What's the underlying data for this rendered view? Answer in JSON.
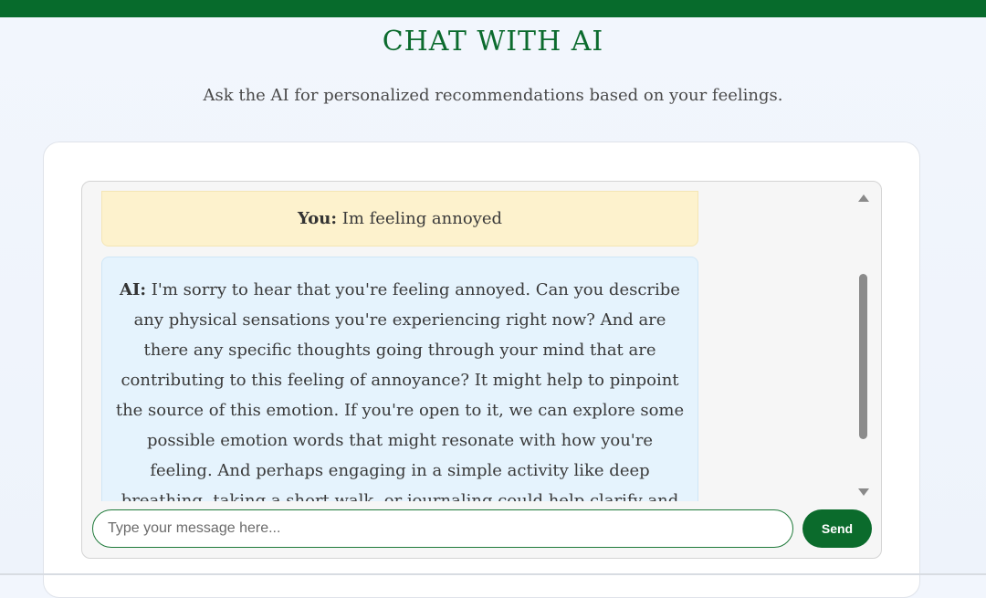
{
  "header": {
    "title": "CHAT WITH AI",
    "subtitle": "Ask the AI for personalized recommendations based on your feelings."
  },
  "chat": {
    "messages": [
      {
        "sender": "You:",
        "text": "Im feeling annoyed"
      },
      {
        "sender": "AI:",
        "text": "I'm sorry to hear that you're feeling annoyed. Can you describe any physical sensations you're experiencing right now? And are there any specific thoughts going through your mind that are contributing to this feeling of annoyance? It might help to pinpoint the source of this emotion. If you're open to it, we can explore some possible emotion words that might resonate with how you're feeling. And perhaps engaging in a simple activity like deep breathing, taking a short walk, or journaling could help clarify and process"
      }
    ],
    "input_placeholder": "Type your message here...",
    "input_value": "",
    "send_label": "Send"
  },
  "icons": {
    "scroll_up": "triangle-up-icon",
    "scroll_down": "triangle-down-icon"
  },
  "colors": {
    "brand_green": "#076b2c",
    "user_bubble": "#fdf2cd",
    "ai_bubble": "#e5f3fd"
  }
}
